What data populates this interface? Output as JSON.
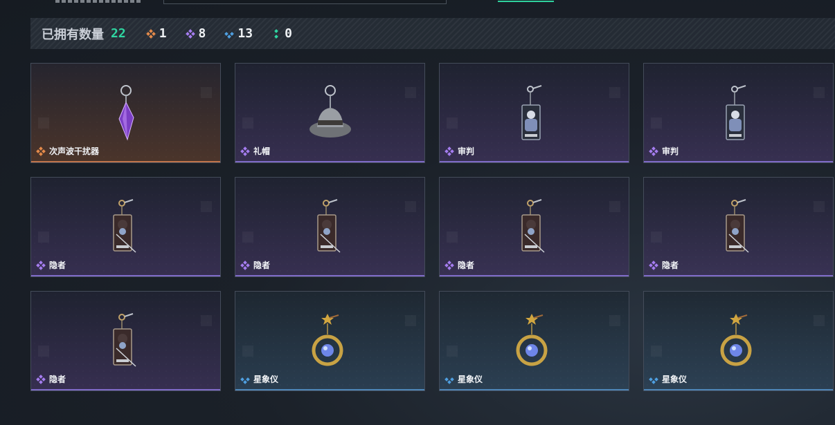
{
  "summary": {
    "owned_label": "已拥有数量",
    "owned_total": "22",
    "tiers": [
      {
        "rarity": "orange",
        "icon": "orange-rarity-icon",
        "count": "1"
      },
      {
        "rarity": "purple",
        "icon": "purple-rarity-icon",
        "count": "8"
      },
      {
        "rarity": "blue",
        "icon": "blue-rarity-icon",
        "count": "13"
      },
      {
        "rarity": "green",
        "icon": "green-rarity-icon",
        "count": "0"
      }
    ]
  },
  "colors": {
    "accent_green": "#2fd6a1",
    "rarity_orange": "#e48a4a",
    "rarity_purple": "#a57df0",
    "rarity_blue": "#4f9fe0"
  },
  "items": [
    {
      "name": "次声波干扰器",
      "rarity": "orange",
      "icon": "crystal-pendant-icon"
    },
    {
      "name": "礼帽",
      "rarity": "purple",
      "icon": "fedora-hat-icon"
    },
    {
      "name": "审判",
      "rarity": "purple",
      "icon": "judgement-tarot-card-icon"
    },
    {
      "name": "审判",
      "rarity": "purple",
      "icon": "judgement-tarot-card-icon"
    },
    {
      "name": "隐者",
      "rarity": "purple",
      "icon": "hermit-tarot-card-icon"
    },
    {
      "name": "隐者",
      "rarity": "purple",
      "icon": "hermit-tarot-card-icon"
    },
    {
      "name": "隐者",
      "rarity": "purple",
      "icon": "hermit-tarot-card-icon"
    },
    {
      "name": "隐者",
      "rarity": "purple",
      "icon": "hermit-tarot-card-icon"
    },
    {
      "name": "隐者",
      "rarity": "purple",
      "icon": "hermit-tarot-card-icon"
    },
    {
      "name": "星象仪",
      "rarity": "blue",
      "icon": "astrolabe-charm-icon"
    },
    {
      "name": "星象仪",
      "rarity": "blue",
      "icon": "astrolabe-charm-icon"
    },
    {
      "name": "星象仪",
      "rarity": "blue",
      "icon": "astrolabe-charm-icon"
    }
  ]
}
